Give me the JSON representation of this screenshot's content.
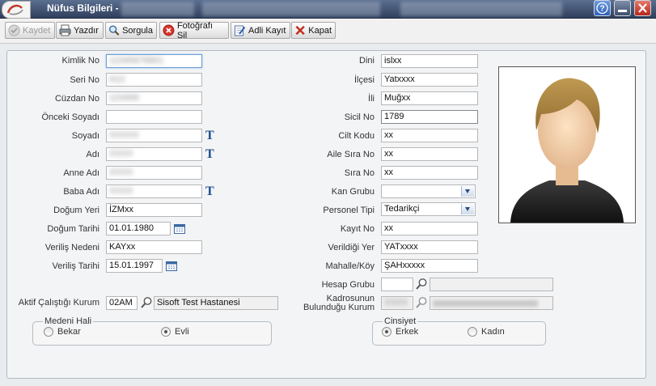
{
  "window": {
    "title": "Nüfus Bilgileri - ",
    "colors": {
      "titlebar": "#3a4b6b",
      "accent": "#1f4f8f"
    }
  },
  "toolbar": {
    "save": "Kaydet",
    "print": "Yazdır",
    "query": "Sorgula",
    "delete_photo": "Fotoğrafı Sil",
    "named_record": "Adli Kayıt",
    "close": "Kapat"
  },
  "left": {
    "kimlik_no": {
      "label": "Kimlik No",
      "value": "12345678901"
    },
    "seri_no": {
      "label": "Seri No",
      "value": "A12"
    },
    "cuzdan_no": {
      "label": "Cüzdan No",
      "value": "123456"
    },
    "onceki_soyadi": {
      "label": "Önceki Soyadı",
      "value": ""
    },
    "soyadi": {
      "label": "Soyadı",
      "value": "XXXXX"
    },
    "adi": {
      "label": "Adı",
      "value": "XXXX"
    },
    "anne_adi": {
      "label": "Anne Adı",
      "value": "XXXX"
    },
    "baba_adi": {
      "label": "Baba Adı",
      "value": "XXXX"
    },
    "dogum_yeri": {
      "label": "Doğum Yeri",
      "value": "İZMxx"
    },
    "dogum_tarihi": {
      "label": "Doğum Tarihi",
      "value": "01.01.1980"
    },
    "verilis_nedeni": {
      "label": "Veriliş Nedeni",
      "value": "KAYxx"
    },
    "verilis_tarihi": {
      "label": "Veriliş Tarihi",
      "value": "15.01.1997"
    },
    "aktif_kurum": {
      "label": "Aktif Çalıştığı Kurum",
      "code": "02AM",
      "name": "Sisoft Test Hastanesi"
    }
  },
  "right": {
    "dini": {
      "label": "Dini",
      "value": "islxx"
    },
    "ilcesi": {
      "label": "İlçesi",
      "value": "Yatxxxx"
    },
    "ili": {
      "label": "İli",
      "value": "Muğxx"
    },
    "sicil_no": {
      "label": "Sicil No",
      "value": "1789"
    },
    "cilt_kodu": {
      "label": "Cilt Kodu",
      "value": "xx"
    },
    "aile_sira_no": {
      "label": "Aile Sıra No",
      "value": "xx"
    },
    "sira_no": {
      "label": "Sıra No",
      "value": "xx"
    },
    "kan_grubu": {
      "label": "Kan Grubu",
      "value": ""
    },
    "personel_tipi": {
      "label": "Personel Tipi",
      "value": "Tedarikçi"
    },
    "kayit_no": {
      "label": "Kayıt No",
      "value": "xx"
    },
    "verildigi_yer": {
      "label": "Verildiği Yer",
      "value": "YATxxxx"
    },
    "mahalle_koy": {
      "label": "Mahalle/Köy",
      "value": "ŞAHxxxxx"
    },
    "hesap_grubu": {
      "label": "Hesap Grubu",
      "value": ""
    },
    "kadro_line1": "Kadrosunun",
    "kadro_line2": "Bulunduğu Kurum",
    "kadro_code": "XXXX"
  },
  "marital": {
    "title": "Medeni Hali",
    "options": [
      "Bekar",
      "Evli"
    ],
    "selected": "Evli"
  },
  "gender": {
    "title": "Cinsiyet",
    "options": [
      "Erkek",
      "Kadın"
    ],
    "selected": "Erkek"
  }
}
